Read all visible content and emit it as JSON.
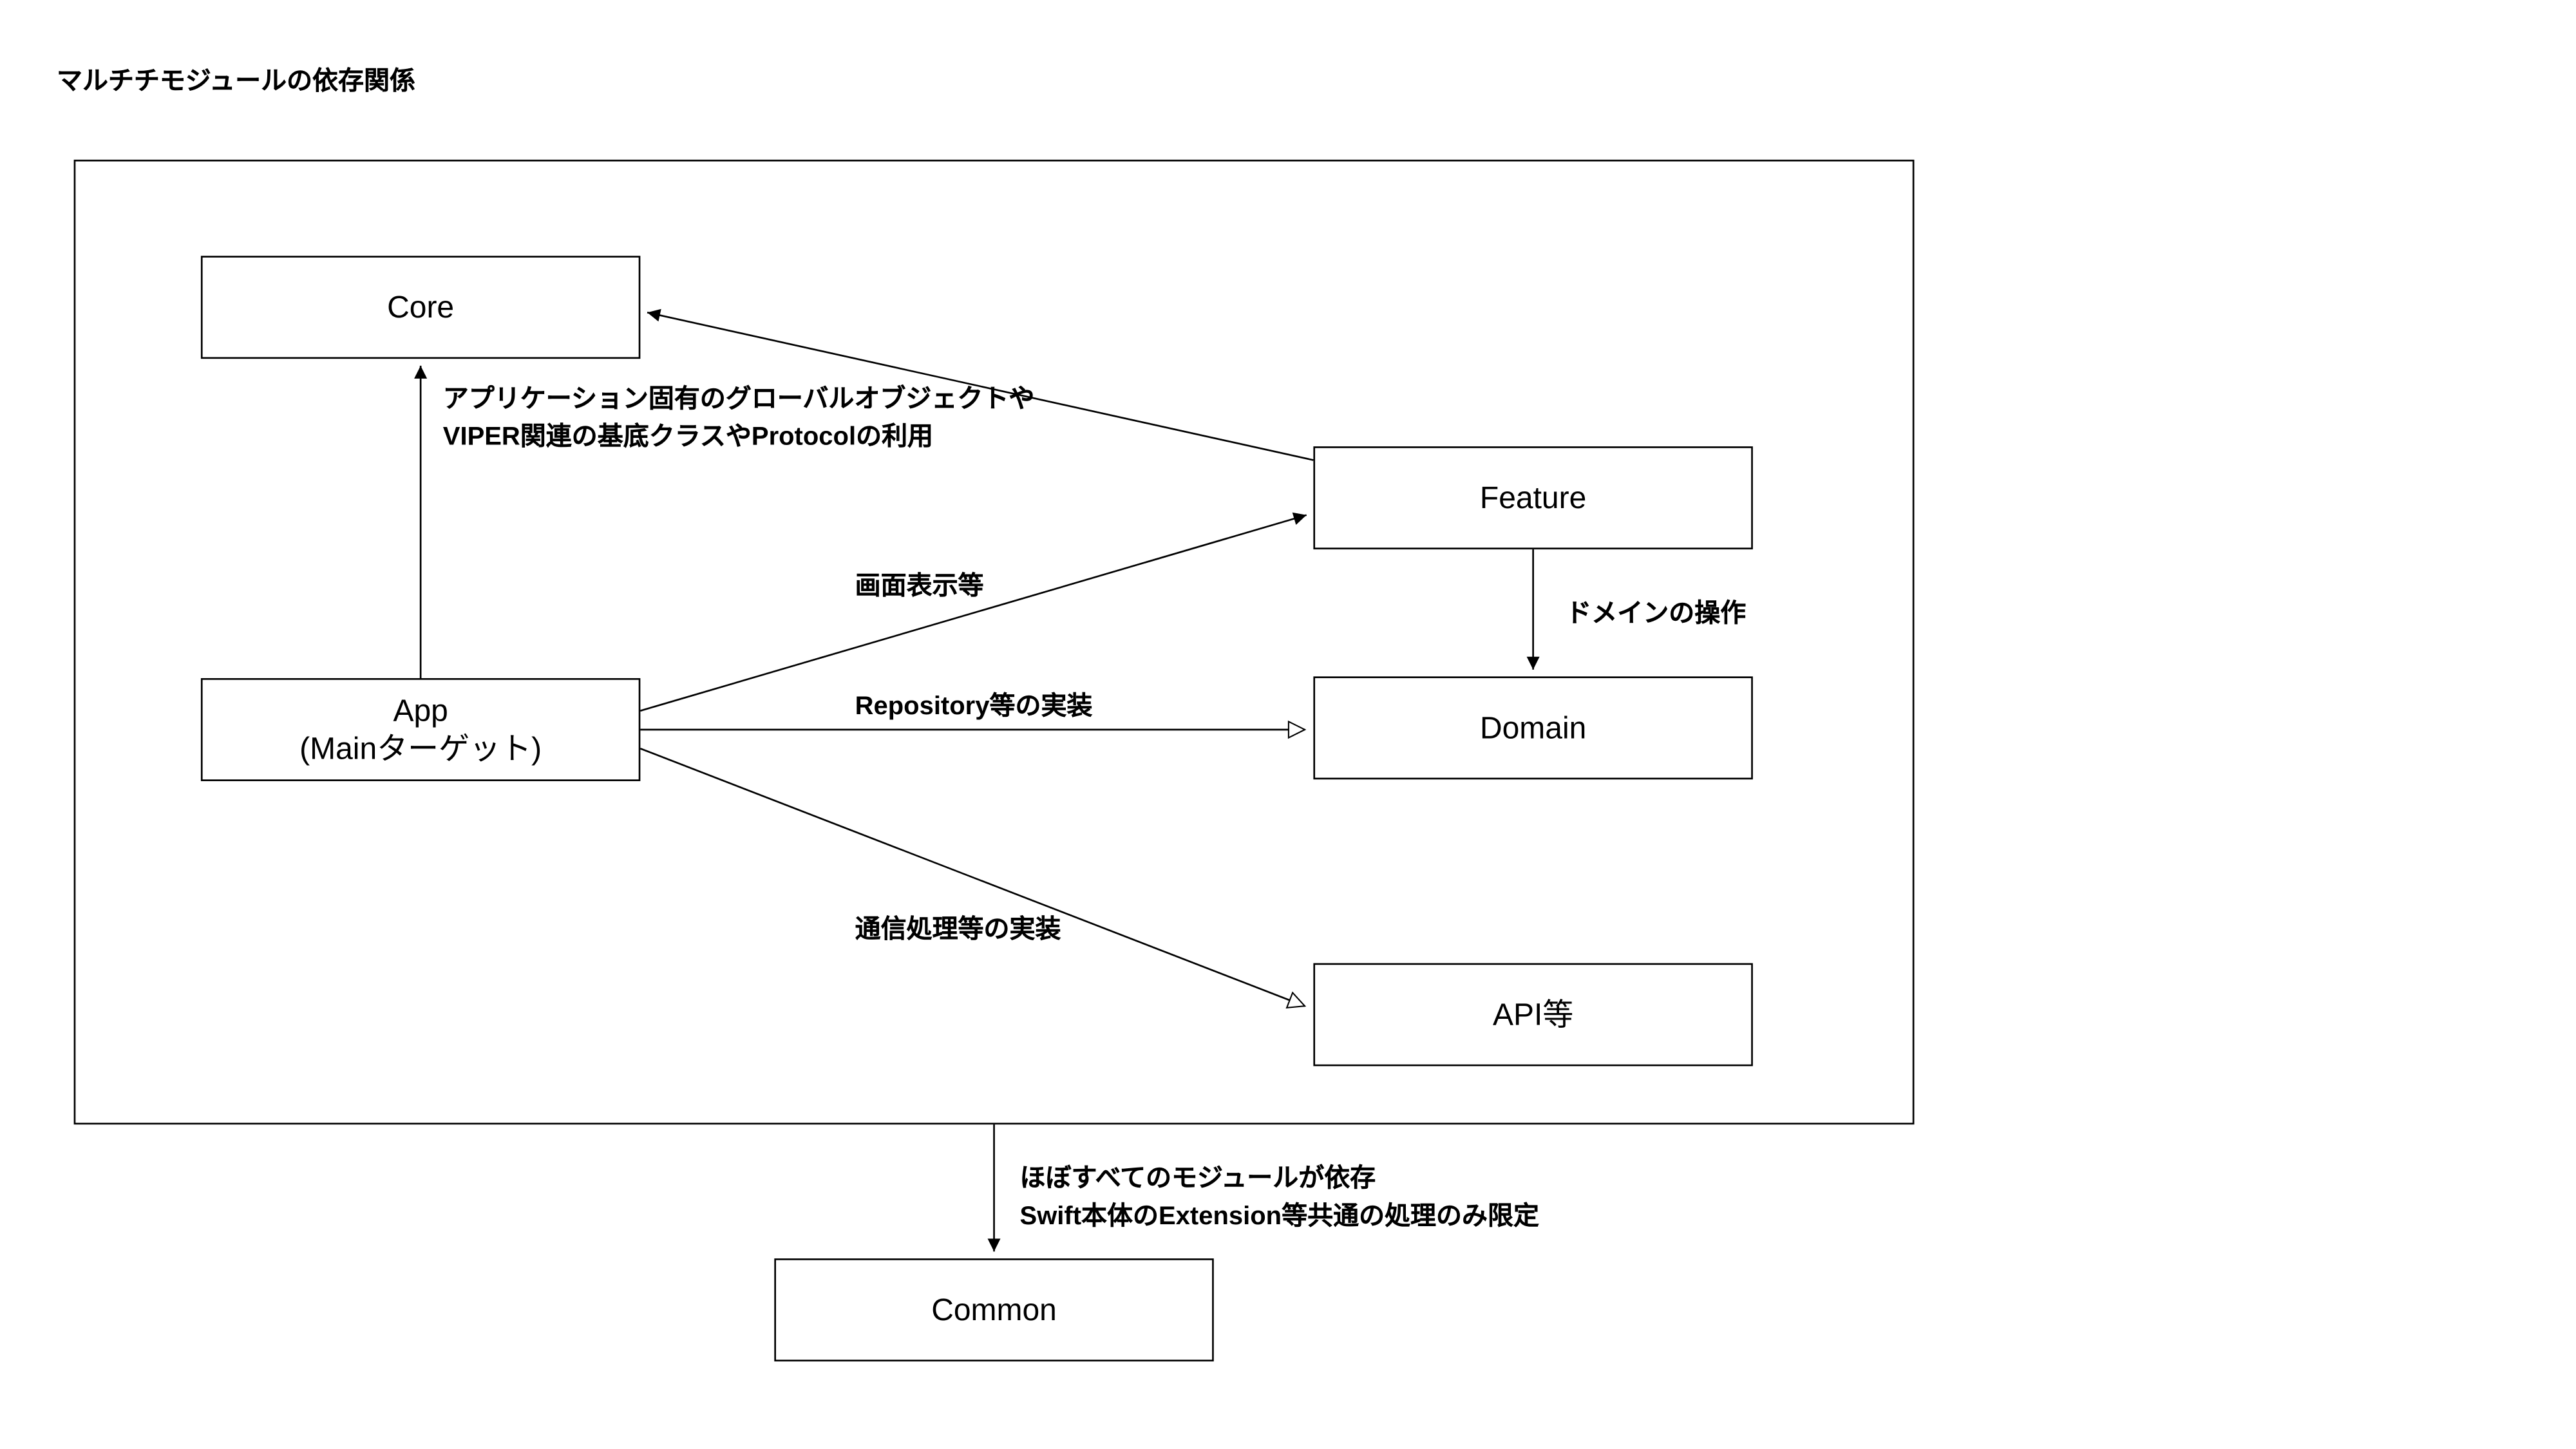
{
  "title": "マルチチモジュールの依存関係",
  "nodes": {
    "core": "Core",
    "app_line1": "App",
    "app_line2": "(Mainターゲット)",
    "feature": "Feature",
    "domain": "Domain",
    "api": "API等",
    "common": "Common"
  },
  "labels": {
    "core_label_line1": "アプリケーション固有のグローバルオブジェクトや",
    "core_label_line2": "VIPER関連の基底クラスやProtocolの利用",
    "feature_label": "画面表示等",
    "feature_to_domain_label": "ドメインの操作",
    "domain_label": "Repository等の実装",
    "api_label": "通信処理等の実装",
    "common_label_line1": "ほぼすべてのモジュールが依存",
    "common_label_line2": "Swift本体のExtension等共通の処理のみ限定"
  }
}
